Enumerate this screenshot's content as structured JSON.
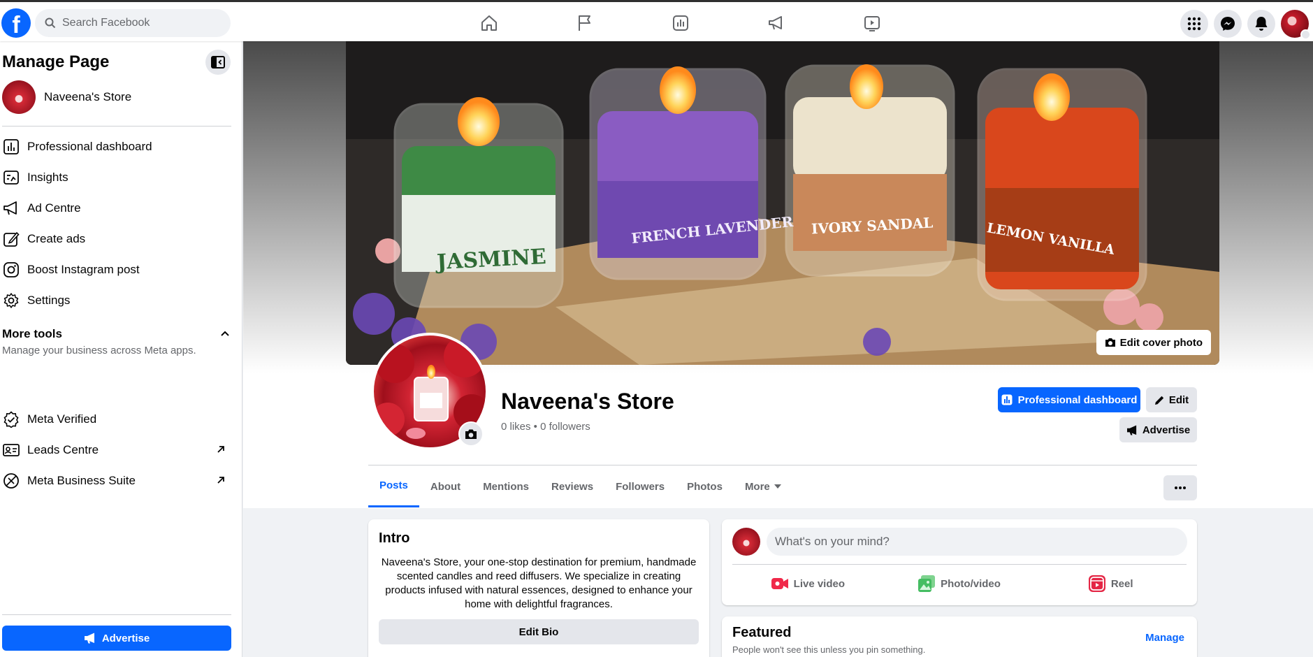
{
  "topbar": {
    "logo": "f",
    "search_placeholder": "Search Facebook",
    "nav_icons": [
      "home-icon",
      "flag-icon",
      "insights-icon",
      "megaphone-icon",
      "video-icon"
    ],
    "right_icons": [
      "menu-grid-icon",
      "messenger-icon",
      "bell-icon"
    ]
  },
  "sidebar": {
    "title": "Manage Page",
    "page_name": "Naveena's Store",
    "items": [
      {
        "label": "Professional dashboard",
        "icon": "dashboard-icon"
      },
      {
        "label": "Insights",
        "icon": "insights-icon"
      },
      {
        "label": "Ad Centre",
        "icon": "megaphone-icon"
      },
      {
        "label": "Create ads",
        "icon": "pencil-icon"
      },
      {
        "label": "Boost Instagram post",
        "icon": "instagram-icon"
      },
      {
        "label": "Settings",
        "icon": "gear-icon"
      }
    ],
    "more_tools": {
      "title": "More tools",
      "subtitle": "Manage your business across Meta apps."
    },
    "tools": [
      {
        "label": "Meta Verified",
        "icon": "verified-badge-icon"
      },
      {
        "label": "Leads Centre",
        "icon": "leads-icon"
      },
      {
        "label": "Meta Business Suite",
        "icon": "business-suite-icon"
      }
    ],
    "advertise_label": "Advertise"
  },
  "cover": {
    "edit_label": "Edit cover photo",
    "candles": [
      "JASMINE",
      "FRENCH LAVENDER",
      "IVORY SANDAL",
      "LEMON VANILLA"
    ],
    "label_colors": [
      "#3e8a45",
      "#8a5cc2",
      "#e8dcc2",
      "#d9471c"
    ]
  },
  "profile": {
    "name": "Naveena's Store",
    "stats": "0 likes • 0 followers",
    "buttons": {
      "professional_dashboard": "Professional dashboard",
      "edit": "Edit",
      "advertise": "Advertise"
    }
  },
  "tabs": [
    "Posts",
    "About",
    "Mentions",
    "Reviews",
    "Followers",
    "Photos",
    "More"
  ],
  "active_tab": "Posts",
  "intro": {
    "title": "Intro",
    "bio": "Naveena's Store, your one-stop destination for premium, handmade scented candles and reed diffusers. We specialize in creating products infused with natural essences, designed to enhance your home with delightful fragrances.",
    "edit_bio_label": "Edit Bio"
  },
  "composer": {
    "placeholder": "What's on your mind?",
    "actions": [
      "Live video",
      "Photo/video",
      "Reel"
    ]
  },
  "featured": {
    "title": "Featured",
    "subtitle": "People won't see this unless you pin something.",
    "manage_label": "Manage"
  },
  "colors": {
    "accent": "#0866ff",
    "live_red": "#f02849",
    "photo_green": "#45bd62",
    "reel_pink": "#e42645"
  }
}
